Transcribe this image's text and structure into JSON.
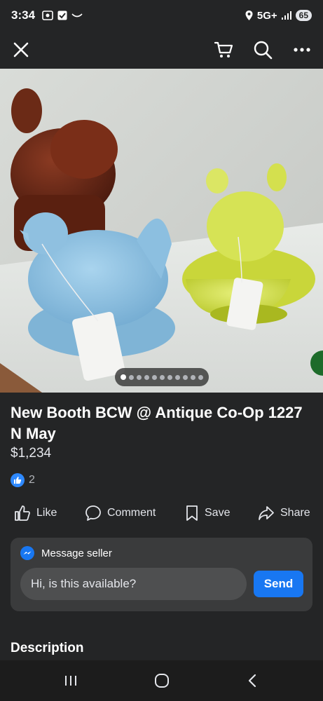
{
  "status_bar": {
    "time": "3:34",
    "network": "5G+",
    "battery": "65"
  },
  "top_bar": {
    "close_icon": "close-icon",
    "cart_icon": "cart-icon",
    "search_icon": "search-icon",
    "more_icon": "more-icon"
  },
  "gallery": {
    "total_images": 11,
    "active_index": 0
  },
  "listing": {
    "title": "New Booth BCW @ Antique Co-Op 1227 N May",
    "price": "$1,234",
    "like_count": "2"
  },
  "actions": {
    "like": "Like",
    "comment": "Comment",
    "save": "Save",
    "share": "Share"
  },
  "message": {
    "header": "Message seller",
    "input_value": "Hi, is this available?",
    "send": "Send"
  },
  "description": {
    "heading": "Description"
  },
  "colors": {
    "background": "#242526",
    "accent": "#1877f2",
    "card": "#3a3b3c"
  }
}
